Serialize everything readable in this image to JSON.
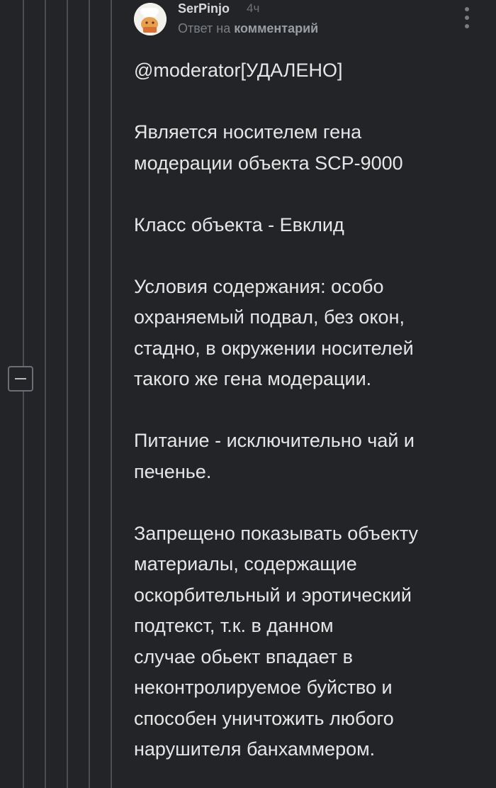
{
  "comment": {
    "author": "SerPinjo",
    "time": "4ч",
    "reply_prefix": "Ответ на",
    "reply_link": "комментарий",
    "paragraphs": [
      [
        "@moderator[УДАЛЕНО]"
      ],
      [
        "Является носителем гена",
        "модерации объекта SCP-9000"
      ],
      [
        "Класс объекта - Евклид"
      ],
      [
        "Условия содержания: особо",
        "охраняемый подвал, без окон,",
        "стадно, в окружении носителей",
        "такого же гена модерации."
      ],
      [
        "Питание - исключительно чай и",
        "печенье."
      ],
      [
        "Запрещено показывать объекту",
        "материалы, содержащие",
        "оскорбительный и эротический",
        "подтекст, т.к. в данном",
        "случае обьект впадает в",
        "неконтролируемое буйство и",
        "способен уничтожить любого",
        "нарушителя банхаммером."
      ]
    ]
  },
  "icons": {
    "avatar": "chef-avatar",
    "menu": "more-vertical-icon",
    "collapse": "collapse-minus-icon"
  },
  "colors": {
    "background": "#222427",
    "thread_line": "#4a4d51",
    "text": "#e6e6e6",
    "muted": "#7c8084"
  }
}
